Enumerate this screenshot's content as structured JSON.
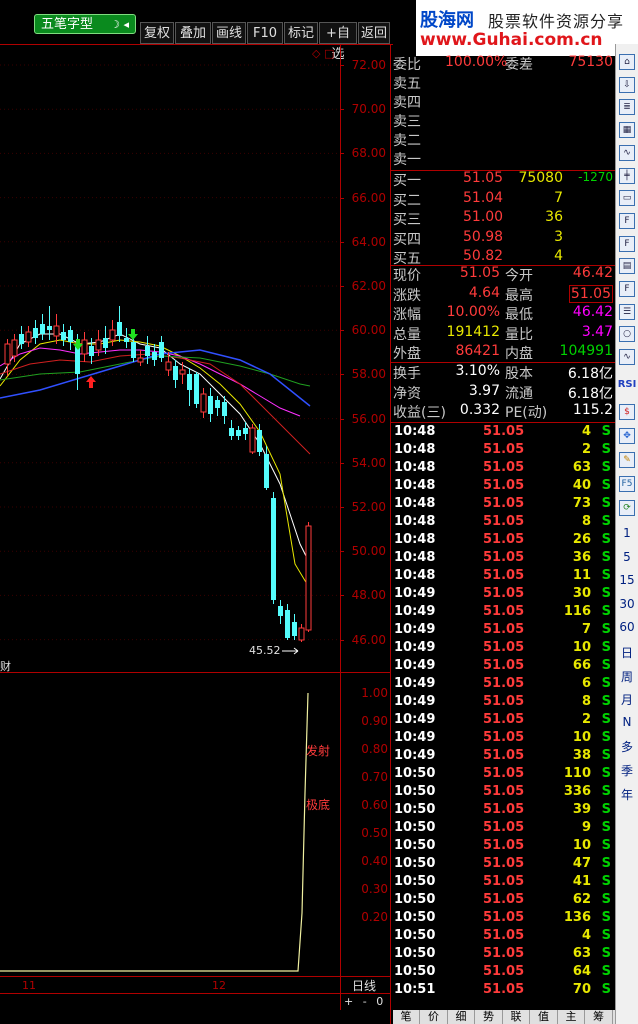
{
  "toolbar": {
    "formula_name": "五笔字型",
    "buttons": [
      "复权",
      "叠加",
      "画线",
      "F10",
      "标记",
      "+自选",
      "返回"
    ]
  },
  "logo": {
    "brand": "股海网",
    "slogan": "股票软件资源分享",
    "url": "www.Guhai.com.cn"
  },
  "chart": {
    "price_axis": [
      "72.00",
      "70.00",
      "68.00",
      "66.00",
      "64.00",
      "62.00",
      "60.00",
      "58.00",
      "56.00",
      "54.00",
      "52.00",
      "50.00",
      "48.00",
      "46.00"
    ],
    "low_annotation": "45.52",
    "sub_axis": [
      "1.00",
      "0.90",
      "0.80",
      "0.70",
      "0.60",
      "0.50",
      "0.40",
      "0.30",
      "0.20"
    ],
    "sub_labels": [
      "发射",
      "极底"
    ],
    "sub_title_fragment": "财",
    "date_labels": [
      "11",
      "12"
    ],
    "period": "日线",
    "zoom_controls": [
      "+",
      "-",
      "0"
    ],
    "markers": [
      "◇",
      "□"
    ]
  },
  "quote": {
    "weibi_label": "委比",
    "weibi_value": "100.00%",
    "weicha_label": "委差",
    "weicha_value": "75130",
    "sell": [
      {
        "label": "卖五"
      },
      {
        "label": "卖四"
      },
      {
        "label": "卖三"
      },
      {
        "label": "卖二"
      },
      {
        "label": "卖一"
      }
    ],
    "buy": [
      {
        "label": "买一",
        "price": "51.05",
        "vol": "75080",
        "chg": "-1270"
      },
      {
        "label": "买二",
        "price": "51.04",
        "vol": "7",
        "chg": ""
      },
      {
        "label": "买三",
        "price": "51.00",
        "vol": "36",
        "chg": ""
      },
      {
        "label": "买四",
        "price": "50.98",
        "vol": "3",
        "chg": ""
      },
      {
        "label": "买五",
        "price": "50.82",
        "vol": "4",
        "chg": ""
      }
    ],
    "stats": [
      {
        "l1": "现价",
        "v1": "51.05",
        "l2": "今开",
        "v2": "46.42"
      },
      {
        "l1": "涨跌",
        "v1": "4.64",
        "l2": "最高",
        "v2": "51.05"
      },
      {
        "l1": "涨幅",
        "v1": "10.00%",
        "l2": "最低",
        "v2": "46.42"
      },
      {
        "l1": "总量",
        "v1": "191412",
        "l2": "量比",
        "v2": "3.47"
      },
      {
        "l1": "外盘",
        "v1": "86421",
        "l2": "内盘",
        "v2": "104991"
      }
    ],
    "fin": [
      {
        "l1": "换手",
        "v1": "3.10%",
        "l2": "股本",
        "v2": "6.18亿"
      },
      {
        "l1": "净资",
        "v1": "3.97",
        "l2": "流通",
        "v2": "6.18亿"
      },
      {
        "l1": "收益(三)",
        "v1": "0.332",
        "l2": "PE(动)",
        "v2": "115.2"
      }
    ]
  },
  "ticks": [
    {
      "t": "10:48",
      "p": "51.05",
      "v": "4",
      "s": "S"
    },
    {
      "t": "10:48",
      "p": "51.05",
      "v": "2",
      "s": "S"
    },
    {
      "t": "10:48",
      "p": "51.05",
      "v": "63",
      "s": "S"
    },
    {
      "t": "10:48",
      "p": "51.05",
      "v": "40",
      "s": "S"
    },
    {
      "t": "10:48",
      "p": "51.05",
      "v": "73",
      "s": "S"
    },
    {
      "t": "10:48",
      "p": "51.05",
      "v": "8",
      "s": "S"
    },
    {
      "t": "10:48",
      "p": "51.05",
      "v": "26",
      "s": "S"
    },
    {
      "t": "10:48",
      "p": "51.05",
      "v": "36",
      "s": "S"
    },
    {
      "t": "10:48",
      "p": "51.05",
      "v": "11",
      "s": "S"
    },
    {
      "t": "10:49",
      "p": "51.05",
      "v": "30",
      "s": "S"
    },
    {
      "t": "10:49",
      "p": "51.05",
      "v": "116",
      "s": "S"
    },
    {
      "t": "10:49",
      "p": "51.05",
      "v": "7",
      "s": "S"
    },
    {
      "t": "10:49",
      "p": "51.05",
      "v": "10",
      "s": "S"
    },
    {
      "t": "10:49",
      "p": "51.05",
      "v": "66",
      "s": "S"
    },
    {
      "t": "10:49",
      "p": "51.05",
      "v": "6",
      "s": "S"
    },
    {
      "t": "10:49",
      "p": "51.05",
      "v": "8",
      "s": "S"
    },
    {
      "t": "10:49",
      "p": "51.05",
      "v": "2",
      "s": "S"
    },
    {
      "t": "10:49",
      "p": "51.05",
      "v": "10",
      "s": "S"
    },
    {
      "t": "10:49",
      "p": "51.05",
      "v": "38",
      "s": "S"
    },
    {
      "t": "10:50",
      "p": "51.05",
      "v": "110",
      "s": "S"
    },
    {
      "t": "10:50",
      "p": "51.05",
      "v": "336",
      "s": "S"
    },
    {
      "t": "10:50",
      "p": "51.05",
      "v": "39",
      "s": "S"
    },
    {
      "t": "10:50",
      "p": "51.05",
      "v": "9",
      "s": "S"
    },
    {
      "t": "10:50",
      "p": "51.05",
      "v": "10",
      "s": "S"
    },
    {
      "t": "10:50",
      "p": "51.05",
      "v": "47",
      "s": "S"
    },
    {
      "t": "10:50",
      "p": "51.05",
      "v": "41",
      "s": "S"
    },
    {
      "t": "10:50",
      "p": "51.05",
      "v": "62",
      "s": "S"
    },
    {
      "t": "10:50",
      "p": "51.05",
      "v": "136",
      "s": "S"
    },
    {
      "t": "10:50",
      "p": "51.05",
      "v": "4",
      "s": "S"
    },
    {
      "t": "10:50",
      "p": "51.05",
      "v": "63",
      "s": "S"
    },
    {
      "t": "10:50",
      "p": "51.05",
      "v": "64",
      "s": "S"
    },
    {
      "t": "10:51",
      "p": "51.05",
      "v": "70",
      "s": "S"
    }
  ],
  "sidebar": {
    "icons": [
      "home-icon",
      "down-arrow-icon",
      "list-icon",
      "grid-icon",
      "line-chart-icon",
      "candle-icon",
      "window-icon",
      "f10-icon",
      "f-icon",
      "doc-icon",
      "fiz-icon",
      "menu-icon",
      "circle-icon",
      "wave-icon"
    ],
    "rsi_label": "RSI",
    "tools": [
      "dollar-icon",
      "move-icon",
      "pencil-icon",
      "f5-icon",
      "refresh-icon"
    ],
    "periods": [
      "1",
      "5",
      "15",
      "30",
      "60",
      "日",
      "周",
      "月",
      "N",
      "多",
      "季",
      "年"
    ]
  },
  "bottom_tabs": [
    "笔",
    "价",
    "细",
    "势",
    "联",
    "值",
    "主",
    "筹"
  ],
  "colors": {
    "up": "#ff3b3b",
    "down": "#54fcfc",
    "axis": "#b00000",
    "text": "#c8c8c8"
  }
}
